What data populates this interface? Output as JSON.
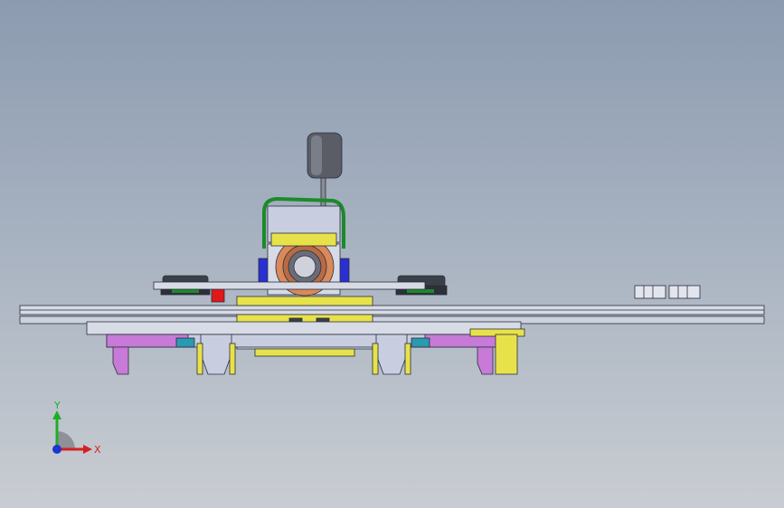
{
  "triad": {
    "y_label": "Y",
    "x_label": "X",
    "y_color": "#1fae2a",
    "x_color": "#d62020",
    "z_color": "#2034d0"
  },
  "model": {
    "icon": "drone-assembly-side-view",
    "colors": {
      "frame": "#d7dbe6",
      "frame_edge": "#2a2e3a",
      "yellow_parts": "#e8e24a",
      "camera_orange": "#d9895a",
      "camera_blue": "#2a2fd0",
      "magenta_parts": "#c87ad8",
      "antenna": "#5a5d66",
      "green_mount": "#1c8a2a",
      "red_part": "#e01818",
      "motor_dark": "#3b3f48"
    }
  }
}
